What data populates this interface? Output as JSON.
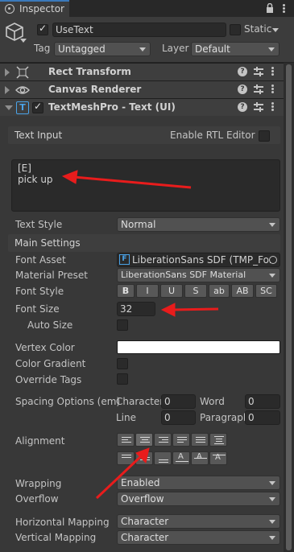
{
  "tab": {
    "title": "Inspector",
    "icon": "info-icon"
  },
  "object": {
    "active": true,
    "name": "UseText",
    "static_label": "Static",
    "tag_label": "Tag",
    "tag_value": "Untagged",
    "layer_label": "Layer",
    "layer_value": "Default"
  },
  "components": [
    {
      "title": "Rect Transform",
      "icon": "rect-transform-icon",
      "expanded": false
    },
    {
      "title": "Canvas Renderer",
      "icon": "eye-icon",
      "expanded": false
    },
    {
      "title": "TextMeshPro - Text (UI)",
      "icon": "textmeshpro-icon",
      "expanded": true,
      "enabled": true
    }
  ],
  "text_input": {
    "header": "Text Input",
    "rtl_label": "Enable RTL Editor",
    "line1": "[E]",
    "line2": "pick up"
  },
  "text_style": {
    "label": "Text Style",
    "value": "Normal"
  },
  "main_settings": {
    "header": "Main Settings",
    "font_asset_label": "Font Asset",
    "font_asset_value": "LiberationSans SDF (TMP_For",
    "material_preset_label": "Material Preset",
    "material_preset_value": "LiberationSans SDF Material",
    "font_style_label": "Font Style",
    "font_style_buttons": [
      "B",
      "I",
      "U",
      "S",
      "ab",
      "AB",
      "SC"
    ],
    "font_size_label": "Font Size",
    "font_size_value": "32",
    "auto_size_label": "Auto Size",
    "vertex_color_label": "Vertex Color",
    "vertex_color": "#ffffff",
    "color_gradient_label": "Color Gradient",
    "override_tags_label": "Override Tags",
    "spacing_label": "Spacing Options (em)",
    "character_label": "Character",
    "character_value": "0",
    "word_label": "Word",
    "word_value": "0",
    "line_label": "Line",
    "line_value": "0",
    "paragraph_label": "Paragraph",
    "paragraph_value": "0",
    "alignment_label": "Alignment",
    "selected_horizontal_alignment": "center",
    "wrapping_label": "Wrapping",
    "wrapping_value": "Enabled",
    "overflow_label": "Overflow",
    "overflow_value": "Overflow",
    "horizontal_mapping_label": "Horizontal Mapping",
    "horizontal_mapping_value": "Character",
    "vertical_mapping_label": "Vertical Mapping",
    "vertical_mapping_value": "Character"
  },
  "colors": {
    "panel_bg": "#383838",
    "annotation_arrow": "#e81c1c",
    "accent": "#3a79bb"
  }
}
